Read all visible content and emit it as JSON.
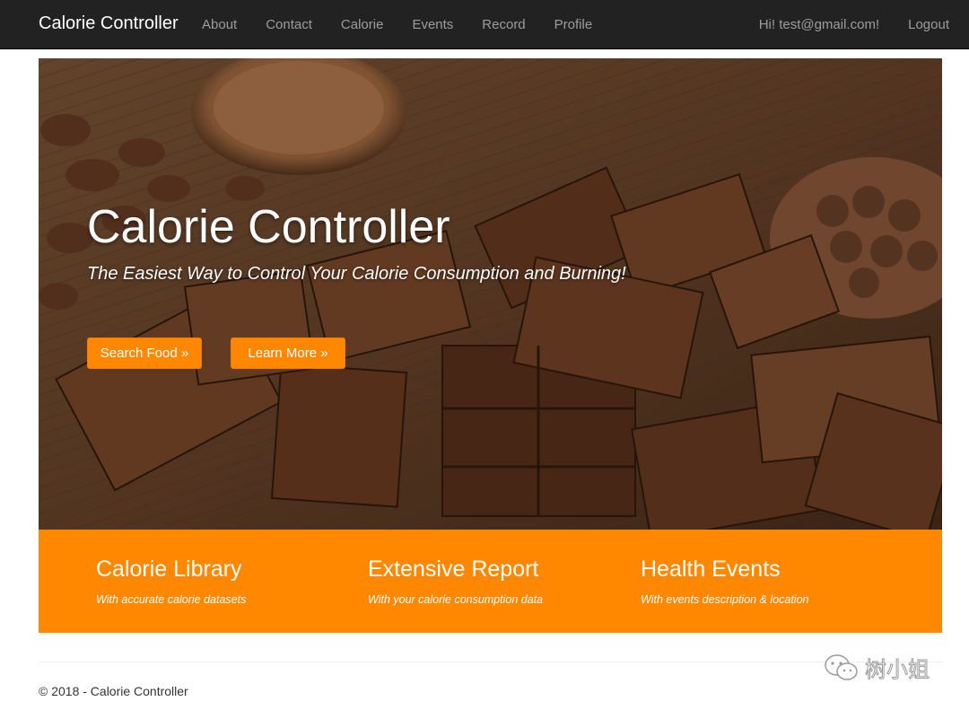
{
  "navbar": {
    "brand": "Calorie Controller",
    "links": [
      "About",
      "Contact",
      "Calorie",
      "Events",
      "Record",
      "Profile"
    ],
    "greeting": "Hi! test@gmail.com!",
    "logout": "Logout"
  },
  "hero": {
    "title": "Calorie Controller",
    "subtitle": "The Easiest Way to Control Your Calorie Consumption and Burning!",
    "search_button": "Search Food »",
    "learn_button": "Learn More »"
  },
  "features": [
    {
      "title": "Calorie Library",
      "desc": "With accurate calorie datasets"
    },
    {
      "title": "Extensive Report",
      "desc": "With your calorie consumption data"
    },
    {
      "title": "Health Events",
      "desc": "With events description & location"
    }
  ],
  "footer": {
    "copyright": "© 2018 - Calorie Controller"
  },
  "watermark": {
    "text": "树小姐",
    "icon": "wechat-icon"
  },
  "colors": {
    "navbar_bg": "#222222",
    "accent": "#ff8800",
    "nav_link": "#9d9d9d"
  }
}
